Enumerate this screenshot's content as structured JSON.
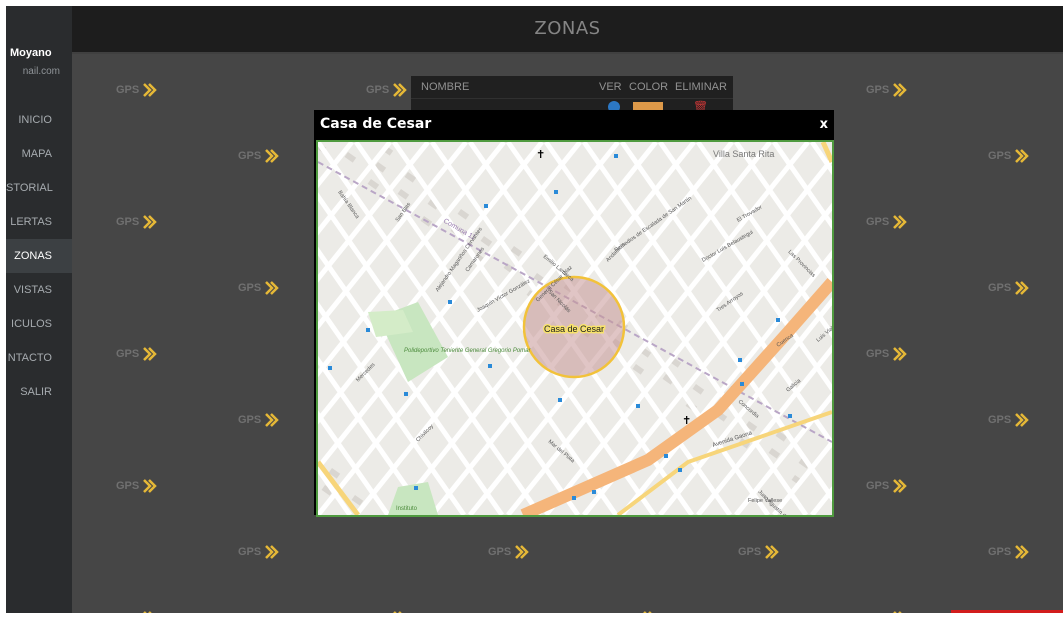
{
  "user": {
    "name": "Moyano",
    "email": "nail.com"
  },
  "nav": [
    {
      "label": "INICIO",
      "active": false
    },
    {
      "label": "MAPA",
      "active": false
    },
    {
      "label": "STORIAL",
      "active": false
    },
    {
      "label": "LERTAS",
      "active": false
    },
    {
      "label": "ZONAS",
      "active": true
    },
    {
      "label": "VISTAS",
      "active": false
    },
    {
      "label": "ICULOS",
      "active": false
    },
    {
      "label": "NTACTO",
      "active": false
    },
    {
      "label": "SALIR",
      "active": false
    }
  ],
  "page": {
    "title": "ZONAS"
  },
  "watermark": {
    "text": "GPS",
    "icon": "gps-chevron-icon",
    "color": "#f2c23a"
  },
  "zones_table": {
    "headers": {
      "nombre": "NOMBRE",
      "ver": "VER",
      "color": "COLOR",
      "eliminar": "ELIMINAR"
    }
  },
  "modal": {
    "title": "Casa de Cesar",
    "close_label": "x"
  },
  "map": {
    "zone_label": "Casa de Cesar",
    "zone_fill": "#c79596",
    "zone_border": "#f2c23a",
    "avenue_color": "#f5b57a",
    "park_color": "#c8e6c0",
    "labels": {
      "neighborhood": "Villa Santa Rita",
      "park": "Polideportivo Teniente General Gregorio Pomar",
      "comuna": "Comuna 11",
      "avenida": "Avenida Gaona",
      "instituto": "Instituto",
      "streets": [
        "Bahía Blanca",
        "San Blas",
        "Camarones",
        "Emilio Lamarca",
        "General César Díaz",
        "Remedios de Escalada de San Martín",
        "El Trovador",
        "Doctor Luis Belaustegui",
        "Tres Arroyos",
        "Cuenca",
        "Galicia",
        "Concordia",
        "San Nicolás",
        "Mercedes",
        "Chivilcoy",
        "Juan Agustín García",
        "Mar del Plata",
        "Felipe Vallese",
        "Andalucía",
        "Las Provincias",
        "Joaquín Víctor González",
        "Alejandro Magariños Cervantes",
        "Luis Viale"
      ]
    }
  }
}
